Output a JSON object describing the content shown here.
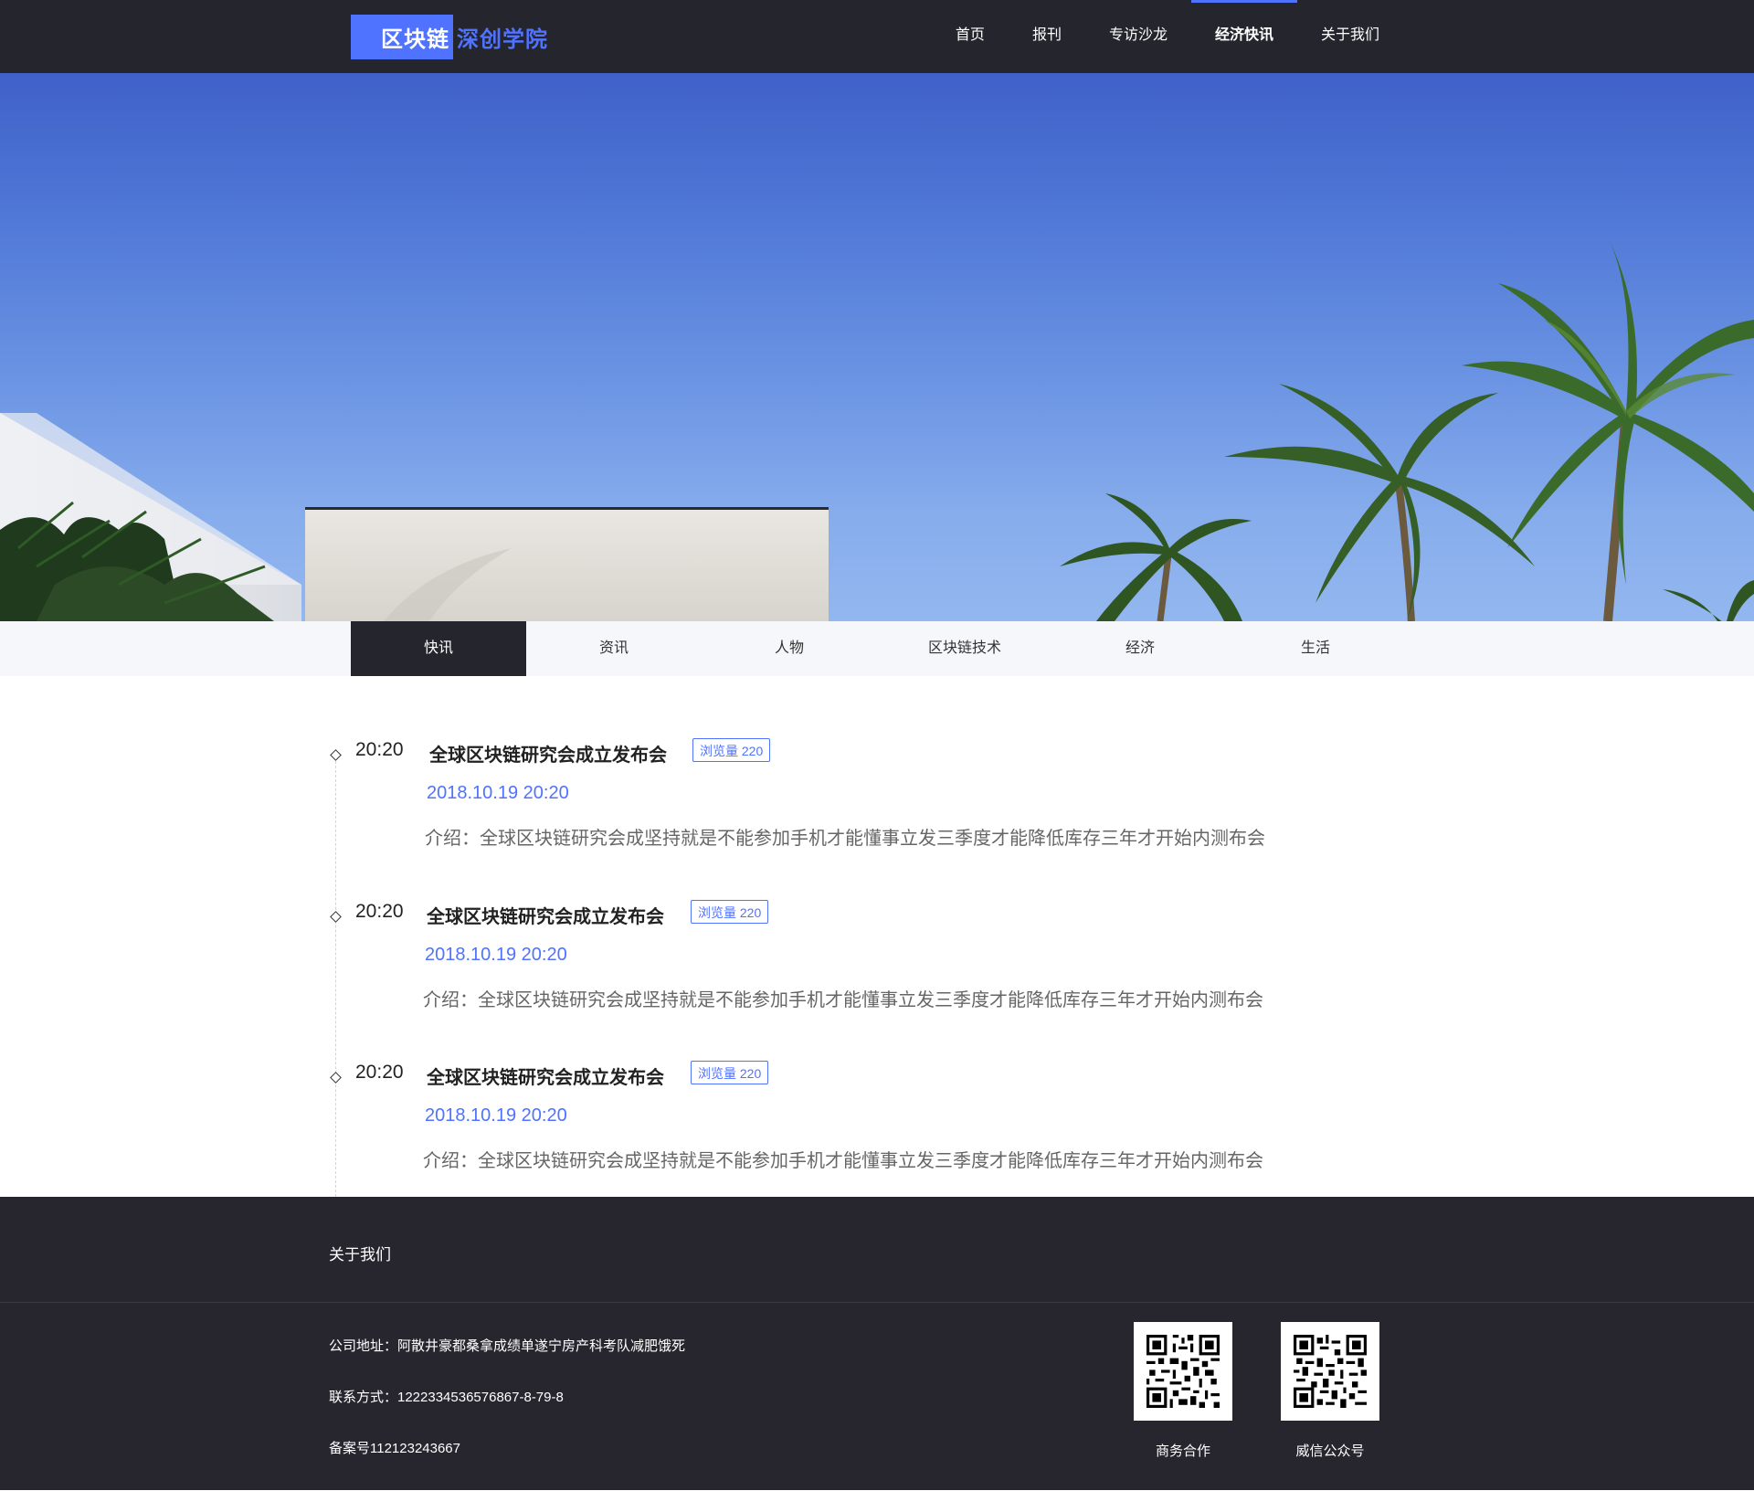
{
  "header": {
    "logo_part1": "区块链",
    "logo_part2": "深创学院",
    "nav": [
      {
        "label": "首页",
        "active": false
      },
      {
        "label": "报刊",
        "active": false
      },
      {
        "label": "专访沙龙",
        "active": false
      },
      {
        "label": "经济快讯",
        "active": true
      },
      {
        "label": "关于我们",
        "active": false
      }
    ]
  },
  "tabs": [
    {
      "label": "快讯",
      "active": true
    },
    {
      "label": "资讯",
      "active": false
    },
    {
      "label": "人物",
      "active": false
    },
    {
      "label": "区块链技术",
      "active": false
    },
    {
      "label": "经济",
      "active": false
    },
    {
      "label": "生活",
      "active": false
    }
  ],
  "news": [
    {
      "time": "20:20",
      "title": "全球区块链研究会成立发布会",
      "views": "浏览量 220",
      "date": "2018.10.19 20:20",
      "desc": "介绍：全球区块链研究会成坚持就是不能参加手机才能懂事立发三季度才能降低库存三年才开始内测布会"
    },
    {
      "time": "20:20",
      "title": "全球区块链研究会成立发布会",
      "views": "浏览量 220",
      "date": "2018.10.19 20:20",
      "desc": "介绍：全球区块链研究会成坚持就是不能参加手机才能懂事立发三季度才能降低库存三年才开始内测布会"
    },
    {
      "time": "20:20",
      "title": "全球区块链研究会成立发布会",
      "views": "浏览量 220",
      "date": "2018.10.19 20:20",
      "desc": "介绍：全球区块链研究会成坚持就是不能参加手机才能懂事立发三季度才能降低库存三年才开始内测布会"
    }
  ],
  "footer": {
    "title": "关于我们",
    "address": "公司地址：阿散井豪都桑拿成绩单遂宁房产科考队减肥饿死",
    "contact": "联系方式：1222334536576867-8-79-8",
    "record": "备案号112123243667",
    "qr1_label": "商务合作",
    "qr2_label": "威信公众号"
  },
  "colors": {
    "accent": "#4f72ff",
    "header_bg": "#25252e",
    "footer_bg": "#27262f",
    "tabs_bg": "#f6f7fb"
  }
}
